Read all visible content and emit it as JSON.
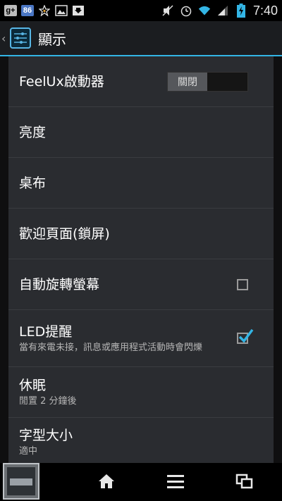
{
  "status_bar": {
    "left_icons": [
      "google-plus-icon",
      "notification-count-icon",
      "star-icon",
      "gallery-icon",
      "download-icon"
    ],
    "gplus_label": "g+",
    "notification_count": "86",
    "time": "7:40",
    "right_icons": [
      "mute-icon",
      "alarm-icon",
      "wifi-icon",
      "signal-icon",
      "battery-icon"
    ]
  },
  "action_bar": {
    "title": "顯示"
  },
  "settings": {
    "feelux": {
      "label": "FeelUx啟動器",
      "toggle_label": "關閉",
      "state": "off"
    },
    "brightness": {
      "label": "亮度"
    },
    "wallpaper": {
      "label": "桌布"
    },
    "lockscreen": {
      "label": "歡迎頁面(鎖屏)"
    },
    "auto_rotate": {
      "label": "自動旋轉螢幕",
      "checked": false
    },
    "led": {
      "label": "LED提醒",
      "summary": "當有來電未接，訊息或應用程式活動時會閃爍",
      "checked": true
    },
    "sleep": {
      "label": "休眠",
      "summary": "閒置 2 分鐘後"
    },
    "font_size": {
      "label": "字型大小",
      "summary": "適中"
    }
  },
  "nav_bar": {
    "icons": [
      "recent-thumbnail",
      "home-icon",
      "menu-icon",
      "recent-apps-icon"
    ]
  },
  "colors": {
    "accent": "#33b5e5",
    "check": "#33b5e5"
  }
}
